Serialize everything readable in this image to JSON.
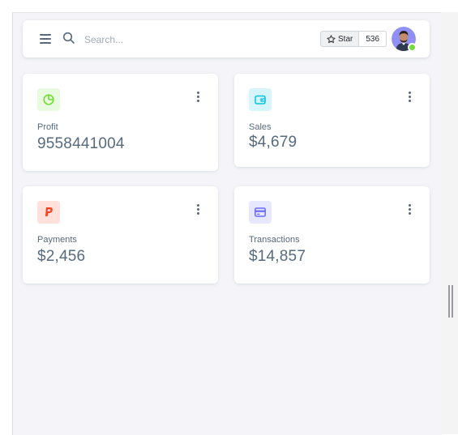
{
  "search": {
    "placeholder": "Search..."
  },
  "github": {
    "star_label": "Star",
    "star_count": "536"
  },
  "colors": {
    "profit_accent": "#71dd37",
    "sales_accent": "#03c3ec",
    "payments_accent": "#ff3e1d",
    "transactions_accent": "#696cff",
    "online_status": "#71dd37"
  },
  "cards": [
    {
      "label": "Profit",
      "value": "9558441004",
      "icon": "pie-chart-icon"
    },
    {
      "label": "Sales",
      "value": "$4,679",
      "icon": "wallet-icon"
    },
    {
      "label": "Payments",
      "value": "$2,456",
      "icon": "paypal-icon"
    },
    {
      "label": "Transactions",
      "value": "$14,857",
      "icon": "credit-card-icon"
    }
  ]
}
